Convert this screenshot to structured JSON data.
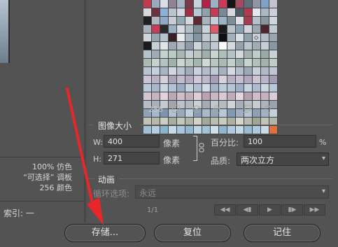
{
  "left_panel": {
    "stats": [
      {
        "value": "100%",
        "label": "仿色"
      },
      {
        "value": "“可选择”",
        "label": "调板"
      },
      {
        "value": "256",
        "label": "颜色"
      }
    ],
    "index_label": "索引: 一"
  },
  "palette": {
    "color_count": "256",
    "toolbar_icons": [
      "web-snap-icon",
      "cube-icon",
      "lock-icon",
      "new-swatch-icon",
      "trash-icon"
    ],
    "swatches": [
      "#c23a4f",
      "#9aa9bf",
      "#d9dde4",
      "#8d8394",
      "#a7b6c6",
      "#7b3b4d",
      "#c7d3dd",
      "#b3204a",
      "#9db1c4",
      "#cc3a56",
      "#141414",
      "#a44a5f",
      "#5d6f79",
      "#8f95a1",
      "#7fa0c8",
      "#c0c4cb",
      "#d5d9df",
      "#6d3240",
      "#8fb0d6",
      "#b9c4cf",
      "#d2d9e3",
      "#a03144",
      "#b6c8d6",
      "#92a0ab",
      "#c43b57",
      "#7c8994",
      "#d8d6de",
      "#4f5c66",
      "#b23a4d",
      "#e3e7ed",
      "#a9b9c3",
      "#c9d0d6",
      "#1f1f22",
      "#b0b7c0",
      "#8fa9c7",
      "#c8ccd4",
      "#94a9b6",
      "#d4d8de",
      "#5c2733",
      "#a7b4bd",
      "#c5ced6",
      "#9fb3c7",
      "#7e8e99",
      "#dde1e6",
      "#a23d52",
      "#b7c0c8",
      "#8996a0",
      "#d0d6dc",
      "#a9b1bb",
      "#c73d58",
      "#2a2a2d",
      "#9bb0c5",
      "#d6dbe1",
      "#b2bec8",
      "#7d8d98",
      "#c9d3dc",
      "#e05a6a",
      "#1c1c1e",
      "#b8c4cd",
      "#8aa1b4",
      "#d1d5db",
      "#9ca8b2",
      "#4c2530",
      "#c2cad1",
      "#cfd5db",
      "#96a4ae",
      "#b7c3cc",
      "#3a1f26",
      "#e8ecf1",
      "#a8b6c1",
      "#8294a2",
      "#c2cbd3",
      "#bfc9d1",
      "#101012",
      "#a3b0ba",
      "#d9dee3",
      "#8fa0ac",
      "#c9d0d7",
      "#b1bdc6",
      "#9aa7b1",
      "#1b1b1d",
      "#c8cfd6",
      "#e0e4e9",
      "#9ea9b3",
      "#b4bfc8",
      "#8d9ba6",
      "#cdd4db",
      "#a6b3bd",
      "#c1c9d0",
      "#fafafa",
      "#d3d9de",
      "#93a2ad",
      "#b9c3cb",
      "#a0acb6",
      "#c6cdd4",
      "#8998a3",
      "#b6c2cb",
      "#9faab4",
      "#c5d3ce",
      "#b8cac4",
      "#a7b8b3",
      "#c3cfd7",
      "#bac6c2",
      "#9db0ab",
      "#c9d5d1",
      "#aebfba",
      "#b5c0c9",
      "#d1d9dd",
      "#a3b4b0",
      "#bfccc8",
      "#99aaa6",
      "#c7d1d6",
      "#a9bab6",
      "#c4d1cd",
      "#b3c3bf",
      "#9fb1ad",
      "#cbd6d2",
      "#bac8c4",
      "#a5b6b2",
      "#d0dad6",
      "#b7c6c2",
      "#aabbb7",
      "#c2cfcb",
      "#9cafab",
      "#c8d4d0",
      "#b0c1bd",
      "#a2b3af",
      "#bfcdc9",
      "#b8c3d0",
      "#c6cddb",
      "#a9b5c4",
      "#d1d6e0",
      "#bcc4d2",
      "#9fabbb",
      "#cbd1dc",
      "#b2bcca",
      "#c1c8d5",
      "#a6b1c1",
      "#d4d9e2",
      "#b5bfcc",
      "#9ca8b8",
      "#c9cfda",
      "#afb9c7",
      "#bec6d3",
      "#c9c3d3",
      "#b8b2c6",
      "#d4cfdc",
      "#aaa3bc",
      "#c2bcce",
      "#b1aac2",
      "#cec8d8",
      "#bfb8cb",
      "#a69fb8",
      "#d7d2de",
      "#b6afc5",
      "#c5bfd1",
      "#aea7bf",
      "#cbc5d6",
      "#bbb5c9",
      "#a39cb5",
      "#b9c9d9",
      "#a6b8cc",
      "#c9d6e2",
      "#b1c2d4",
      "#98adc4",
      "#c2d0de",
      "#aebfd2",
      "#d0dbe5",
      "#a1b4c9",
      "#bccbd9",
      "#b4c5d6",
      "#9bb0c6",
      "#c6d3e0",
      "#abbdd0",
      "#cad7e3",
      "#b7c7d7",
      "#d4c4cf",
      "#c6b3c1",
      "#e0d3dc",
      "#bca7b7",
      "#d0bfcb",
      "#c3afbe",
      "#dccdd7",
      "#b8a2b3",
      "#cab7c5",
      "#d8cad4",
      "#c0abba",
      "#e3d7df",
      "#b4a0b0",
      "#cfbdca",
      "#c5b1c0",
      "#dbcbd6",
      "#b7bcc4",
      "#aab0ba",
      "#c5cad1",
      "#9fa6b1",
      "#bec3ca",
      "#b2b8c1",
      "#cbd0d6",
      "#a4abb5",
      "#c1c6cd",
      "#b5bbc3",
      "#d0d4da",
      "#a8aeb8",
      "#bbc0c8",
      "#c7ccd2",
      "#adb3bc",
      "#9ba2ad",
      "#8fa3b8",
      "#a5b6c8",
      "#7f95ad",
      "#b3c2d1",
      "#96a9bd",
      "#c0cdda",
      "#889db3",
      "#a9bacb",
      "#93a7bb",
      "#bac8d6",
      "#8299b0",
      "#9faec2",
      "#b6c4d3",
      "#8ca0b6",
      "#a2b3c6",
      "#c4d0dc",
      "#bfc3b8",
      "#b4b9ac",
      "#cacdc3",
      "#a8ad9f",
      "#c4c8bc",
      "#b0b4a8",
      "#d1d3ca",
      "#a3a897",
      "#babeb2",
      "#c8cbc0",
      "#adb1a4",
      "#d5d7cf",
      "#b7bbaf",
      "#9fa495",
      "#c1c5b9",
      "#b2b6aa",
      "#9fc0d6",
      "#b6cfe0",
      "#8cb3cc",
      "#c7dae7",
      "#a9c6da",
      "#94b8cf",
      "#bed4e3",
      "#a1c2d7",
      "#d0e0eb",
      "#8fb6ce",
      "#b1cadd",
      "#c3d7e5",
      "#9abcd2",
      "#accadd",
      "#cadbe8",
      "#e2703f"
    ]
  },
  "image_size": {
    "title": "图像大小",
    "width_label": "W:",
    "width_value": "400",
    "height_label": "H:",
    "height_value": "271",
    "unit": "像素",
    "percent_label": "百分比:",
    "percent_value": "100",
    "percent_unit": "%",
    "quality_label": "品质:",
    "quality_value": "两次立方"
  },
  "animation": {
    "title": "动画",
    "loop_label": "循环选项:",
    "loop_value": "永远",
    "frame_counter": "1/1",
    "controls": [
      "◀◀",
      "◀▮",
      "◀",
      "▶",
      "▮▶",
      "▶▶"
    ]
  },
  "footer": {
    "save_label": "存储...",
    "reset_label": "复位",
    "remember_label": "记住"
  },
  "colors": {
    "arrow": "#e8272b",
    "background": "#535353"
  }
}
